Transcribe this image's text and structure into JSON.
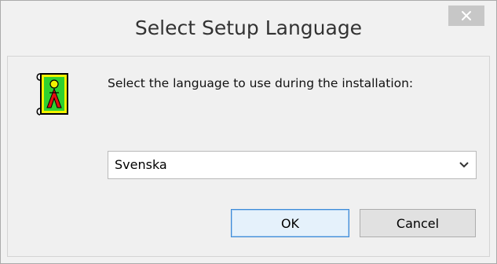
{
  "window": {
    "title": "Select Setup Language",
    "close_label": "×"
  },
  "content": {
    "message": "Select the language to use during the installation:",
    "language_select": {
      "selected": "Svenska"
    }
  },
  "buttons": {
    "ok_label": "OK",
    "cancel_label": "Cancel"
  },
  "icons": {
    "app": "setup-wizard-icon",
    "close": "close-icon",
    "dropdown": "chevron-down-icon"
  },
  "colors": {
    "accent": "#3c8ad8",
    "close_button": "#c7c7c7"
  }
}
